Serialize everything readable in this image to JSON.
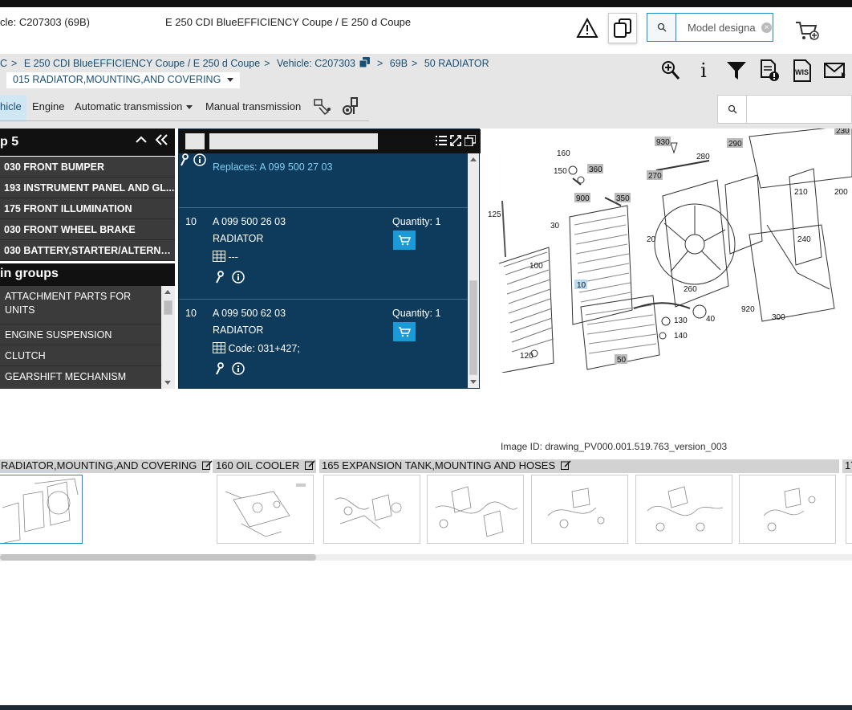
{
  "header": {
    "vehicle": "cle: C207303 (69B)",
    "model": "E 250 CDI BlueEFFICIENCY Coupe / E 250 d Coupe",
    "search_placeholder": "Model designa"
  },
  "breadcrumb": {
    "items": [
      "C",
      "E 250 CDI BlueEFFICIENCY Coupe / E 250 d Coupe",
      "Vehicle: C207303",
      "69B",
      "50 RADIATOR"
    ],
    "separator": ">",
    "subgroup": "015 RADIATOR,MOUNTING,AND COVERING"
  },
  "tabs": [
    "hicle",
    "Engine",
    "Automatic transmission",
    "Manual transmission"
  ],
  "toolbar": {
    "info_label": "i",
    "wis_label": "WIS"
  },
  "left_panel": {
    "title": "p 5",
    "items": [
      "030 FRONT BUMPER",
      "193 INSTRUMENT PANEL AND GL...",
      "175 FRONT ILLUMINATION",
      "030 FRONT WHEEL BRAKE",
      "030 BATTERY,STARTER/ALTERNAT..."
    ],
    "groups_title": "in groups",
    "groups": [
      "ATTACHMENT PARTS FOR UNITS",
      "ENGINE SUSPENSION",
      "CLUTCH",
      "GEARSHIFT MECHANISM"
    ]
  },
  "parts": {
    "replaces": "Replaces: A 099 500 27 03",
    "rows": [
      {
        "pos": "10",
        "number": "A 099 500 26 03",
        "name": "RADIATOR",
        "code": "---",
        "qty": "Quantity: 1"
      },
      {
        "pos": "10",
        "number": "A 099 500 62 03",
        "name": "RADIATOR",
        "code": "Code: 031+427;",
        "qty": "Quantity: 1"
      }
    ]
  },
  "drawing": {
    "labels": [
      "930",
      "290",
      "160",
      "280",
      "150",
      "360",
      "270",
      "900",
      "350",
      "210",
      "200",
      "125",
      "30",
      "20",
      "240",
      "100",
      "10",
      "260",
      "920",
      "300",
      "130",
      "40",
      "140",
      "120",
      "50",
      "230"
    ],
    "image_id": "Image ID: drawing_PV000.001.519.763_version_003"
  },
  "thumbnails": {
    "groups": [
      "RADIATOR,MOUNTING,AND COVERING",
      "160 OIL COOLER",
      "165 EXPANSION TANK,MOUNTING AND HOSES",
      "17"
    ]
  },
  "colors": {
    "accent": "#1a9ad6",
    "panel_dark": "#0e3a5c",
    "link": "#1a4f75"
  }
}
